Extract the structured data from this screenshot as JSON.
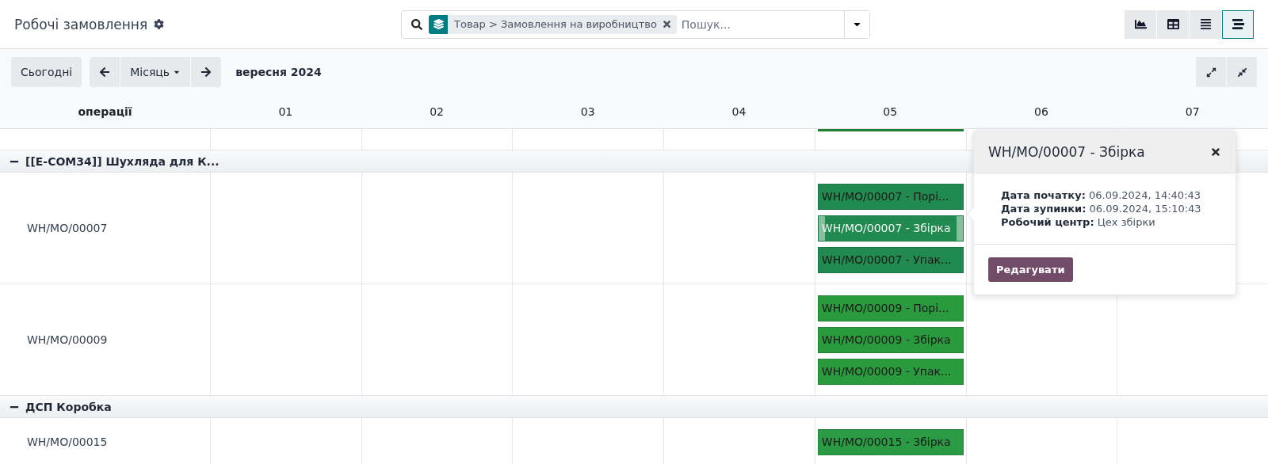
{
  "header": {
    "title": "Робочі замовлення",
    "search": {
      "facet": "Товар > Замовлення на виробництво",
      "placeholder": "Пошук..."
    },
    "views": [
      {
        "kind": "graph",
        "selected": false
      },
      {
        "kind": "pivot",
        "selected": false
      },
      {
        "kind": "list",
        "selected": false
      },
      {
        "kind": "gantt",
        "selected": true
      }
    ]
  },
  "controls": {
    "today": "Сьогодні",
    "scale": "Місяць",
    "period": "вересня 2024"
  },
  "gantt": {
    "header_label": "операції",
    "days": [
      "01",
      "02",
      "03",
      "04",
      "05",
      "06",
      "07"
    ],
    "groups": [
      {
        "name": "[[E-COM34]] Шухляда для К...",
        "expanded": true,
        "rows": [
          {
            "label": "WH/MO/00007",
            "pills": [
              {
                "text": "WH/MO/00007 - Порі...",
                "color": "#218a4e",
                "selected": false
              },
              {
                "text": "WH/MO/00007 - Збірка",
                "color": "#218a4e",
                "selected": true
              },
              {
                "text": "WH/MO/00007 - Упак...",
                "color": "#218a4e",
                "selected": false
              }
            ]
          },
          {
            "label": "WH/MO/00009",
            "pills": [
              {
                "text": "WH/MO/00009 - Порі...",
                "color": "#2a9a3e",
                "selected": false
              },
              {
                "text": "WH/MO/00009 - Збірка",
                "color": "#2a9a3e",
                "selected": false
              },
              {
                "text": "WH/MO/00009 - Упак...",
                "color": "#2a9a3e",
                "selected": false
              }
            ]
          }
        ]
      },
      {
        "name": "ДСП Коробка",
        "expanded": true,
        "rows": [
          {
            "label": "WH/MO/00015",
            "pills": [
              {
                "text": "WH/MO/00015 - Збірка",
                "color": "#2a9a44",
                "selected": false
              }
            ]
          }
        ]
      }
    ]
  },
  "popover": {
    "title": "WH/MO/00007 - Збірка",
    "fields": [
      {
        "label": "Дата початку:",
        "value": "06.09.2024, 14:40:43"
      },
      {
        "label": "Дата зупинки:",
        "value": "06.09.2024, 15:10:43"
      },
      {
        "label": "Робочий центр:",
        "value": "Цех збірки"
      }
    ],
    "button": "Редагувати"
  }
}
